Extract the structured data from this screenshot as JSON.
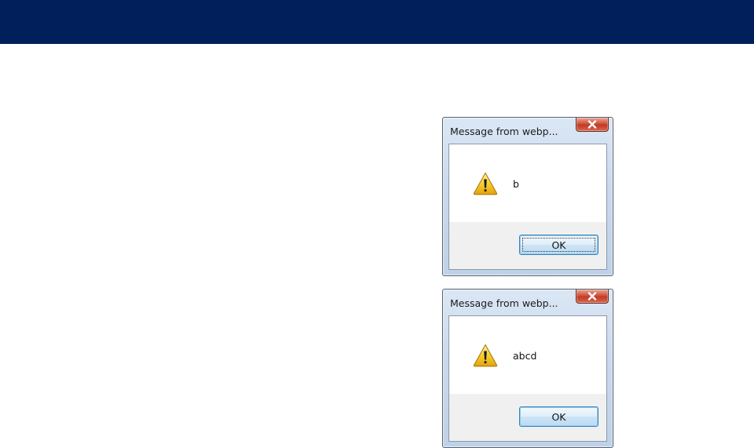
{
  "banner": {
    "color": "#011f5b"
  },
  "dialogs": [
    {
      "title": "Message from webp...",
      "message": "b",
      "ok_label": "OK",
      "has_focus_ring": true,
      "icon": "warning-icon"
    },
    {
      "title": "Message from webp...",
      "message": "abcd",
      "ok_label": "OK",
      "has_focus_ring": false,
      "icon": "warning-icon"
    }
  ]
}
